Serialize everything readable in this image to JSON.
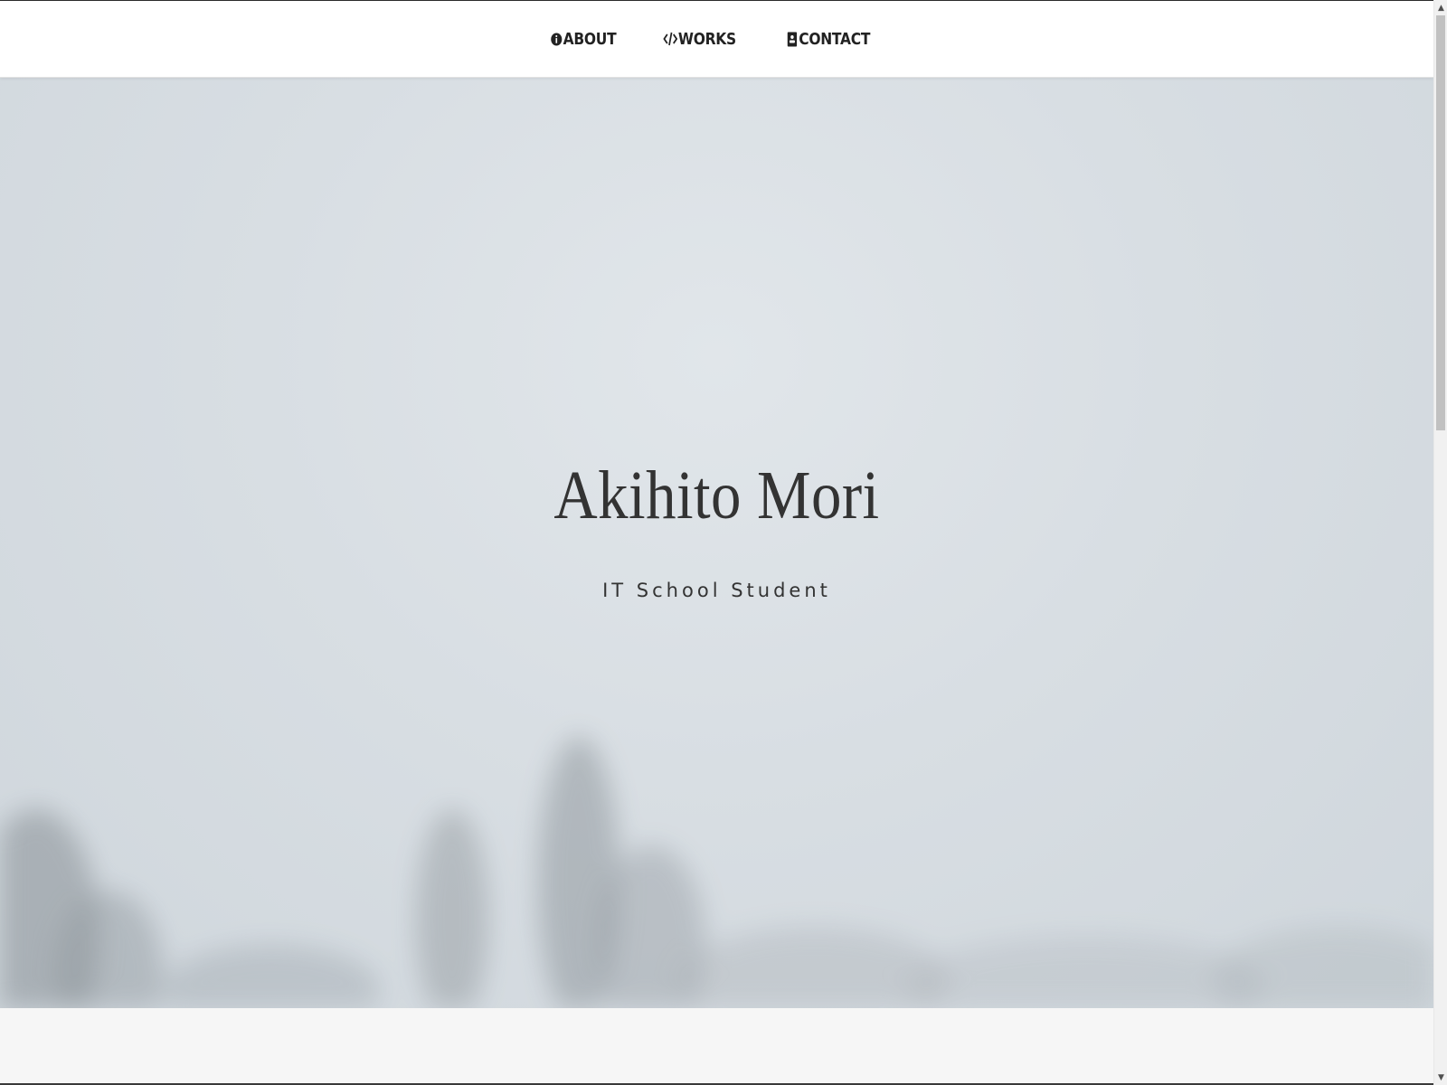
{
  "nav": {
    "items": [
      {
        "label": "ABOUT",
        "icon": "info-circle-icon"
      },
      {
        "label": "WORKS",
        "icon": "code-icon"
      },
      {
        "label": "CONTACT",
        "icon": "address-card-icon"
      }
    ]
  },
  "hero": {
    "name": "Akihito Mori",
    "subtitle": "IT School Student"
  },
  "colors": {
    "nav_background": "#ffffff",
    "nav_text": "#222222",
    "hero_text": "#333333",
    "hero_background": "#d8dee3",
    "page_background": "#f6f6f6"
  },
  "scrollbar": {
    "up_arrow": "▲",
    "down_arrow": "▼"
  }
}
